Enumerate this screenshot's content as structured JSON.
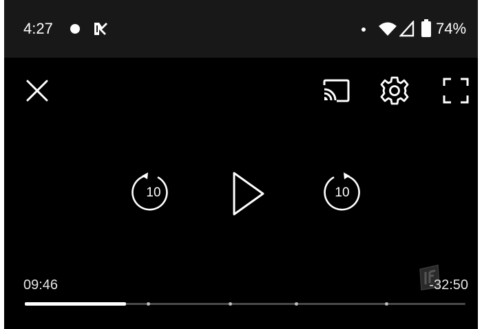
{
  "status_bar": {
    "time": "4:27",
    "battery_percent": "74%"
  },
  "player": {
    "icons": {
      "close": "close-icon",
      "cast": "cast-icon",
      "settings": "gear-icon",
      "fullscreen": "fullscreen-icon",
      "rewind": "rewind-10-icon",
      "play": "play-icon",
      "forward": "forward-10-icon"
    },
    "rewind_label": "10",
    "forward_label": "10",
    "elapsed_time": "09:46",
    "remaining_time": "-32:50",
    "progress": 0.23,
    "chapter_markers": [
      0.28,
      0.465,
      0.615,
      0.82
    ]
  },
  "colors": {
    "background": "#000000",
    "status_bar_bg": "#181818",
    "foreground": "#ffffff",
    "track": "#4a4a4a"
  }
}
